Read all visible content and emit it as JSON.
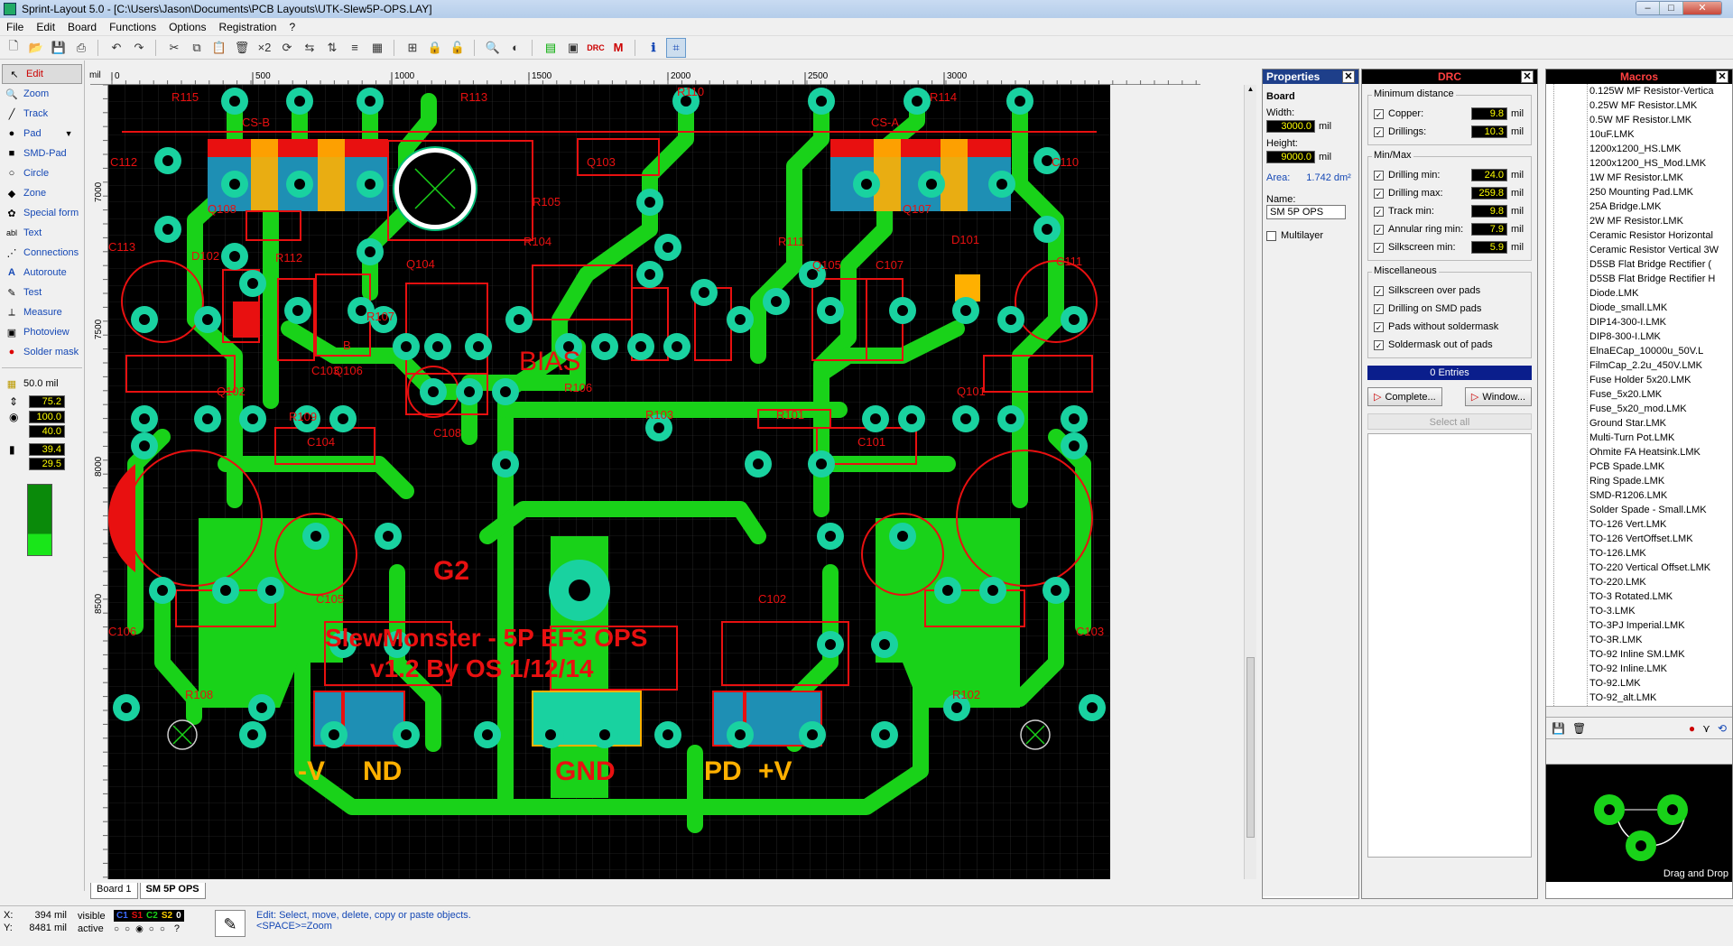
{
  "window": {
    "title": "Sprint-Layout 5.0 - [C:\\Users\\Jason\\Documents\\PCB Layouts\\UTK-Slew5P-OPS.LAY]",
    "min": "–",
    "max": "□",
    "close": "✕"
  },
  "menu": [
    "File",
    "Edit",
    "Board",
    "Functions",
    "Options",
    "Registration",
    "?"
  ],
  "tools": [
    {
      "label": "Edit",
      "icon": "↖"
    },
    {
      "label": "Zoom",
      "icon": "🔍"
    },
    {
      "label": "Track",
      "icon": "╱"
    },
    {
      "label": "Pad",
      "icon": "●"
    },
    {
      "label": "SMD-Pad",
      "icon": "■"
    },
    {
      "label": "Circle",
      "icon": "○"
    },
    {
      "label": "Zone",
      "icon": "◆"
    },
    {
      "label": "Special form",
      "icon": "✿"
    },
    {
      "label": "Text",
      "icon": "abl"
    },
    {
      "label": "Connections",
      "icon": "⋰"
    },
    {
      "label": "Autoroute",
      "icon": "A"
    },
    {
      "label": "Test",
      "icon": "✎"
    },
    {
      "label": "Measure",
      "icon": "⟂"
    },
    {
      "label": "Photoview",
      "icon": "▣"
    },
    {
      "label": "Solder mask",
      "icon": "●"
    }
  ],
  "grid_label": "50.0 mil",
  "track_width": "75.2",
  "pad_outer": "100.0",
  "pad_inner": "40.0",
  "smd_w": "39.4",
  "smd_h": "29.5",
  "ruler": {
    "unit": "mil",
    "top": [
      "0",
      "500",
      "1000",
      "1500",
      "2000",
      "2500",
      "3000"
    ],
    "left": [
      "7000",
      "7500",
      "8000",
      "8500"
    ]
  },
  "board_text": {
    "title1": "SlewMonster - 5P EF3 OPS",
    "title2": "v1.2 By OS 1/12/14",
    "bias": "BIAS",
    "g2": "G2",
    "minus_v": "-V",
    "nd": "ND",
    "gnd": "GND",
    "pd": "PD",
    "plus_v": "+V",
    "labels": [
      "R115",
      "R113",
      "R110",
      "R114",
      "CS-B",
      "CS-A",
      "C112",
      "C110",
      "Q108",
      "Q103",
      "Q107",
      "R105",
      "R104",
      "C113",
      "D102",
      "R112",
      "Q104",
      "R111",
      "Q105",
      "C107",
      "D101",
      "C111",
      "R107",
      "B",
      "C103",
      "Q106",
      "Q102",
      "R109",
      "C108",
      "R106",
      "R103",
      "R101",
      "Q101",
      "C104",
      "C101",
      "C106",
      "C105",
      "C102",
      "C103",
      "R108",
      "R102"
    ]
  },
  "tabs": [
    "Board 1",
    "SM 5P OPS"
  ],
  "properties": {
    "header": "Properties",
    "board": "Board",
    "width_label": "Width:",
    "width": "3000.0",
    "width_unit": "mil",
    "height_label": "Height:",
    "height": "9000.0",
    "height_unit": "mil",
    "area_label": "Area:",
    "area": "1.742 dm²",
    "name_label": "Name:",
    "name": "SM 5P OPS",
    "multilayer": "Multilayer"
  },
  "drc": {
    "header": "DRC",
    "min_dist": "Minimum distance",
    "copper": "Copper:",
    "copper_v": "9.8",
    "drillings": "Drillings:",
    "drillings_v": "10.3",
    "minmax": "Min/Max",
    "drill_min": "Drilling min:",
    "drill_min_v": "24.0",
    "drill_max": "Drilling max:",
    "drill_max_v": "259.8",
    "track_min": "Track min:",
    "track_min_v": "9.8",
    "annular": "Annular ring min:",
    "annular_v": "7.9",
    "silk_min": "Silkscreen min:",
    "silk_min_v": "5.9",
    "misc": "Miscellaneous",
    "m1": "Silkscreen over pads",
    "m2": "Drilling on SMD pads",
    "m3": "Pads without soldermask",
    "m4": "Soldermask out of pads",
    "unit": "mil",
    "entries": "0 Entries",
    "complete": "Complete...",
    "window": "Window...",
    "select_all": "Select all"
  },
  "macros": {
    "header": "Macros",
    "items": [
      "0.125W MF Resistor-Vertica",
      "0.25W MF Resistor.LMK",
      "0.5W MF Resistor.LMK",
      "10uF.LMK",
      "1200x1200_HS.LMK",
      "1200x1200_HS_Mod.LMK",
      "1W MF Resistor.LMK",
      "250 Mounting Pad.LMK",
      "25A Bridge.LMK",
      "2W MF Resistor.LMK",
      "Ceramic Resistor Horizontal",
      "Ceramic Resistor Vertical 3W",
      "D5SB Flat Bridge Rectifier (",
      "D5SB Flat Bridge Rectifier H",
      "Diode.LMK",
      "Diode_small.LMK",
      "DIP14-300-I.LMK",
      "DIP8-300-I.LMK",
      "ElnaECap_10000u_50V.L",
      "FilmCap_2.2u_450V.LMK",
      "Fuse Holder 5x20.LMK",
      "Fuse_5x20.LMK",
      "Fuse_5x20_mod.LMK",
      "Ground Star.LMK",
      "Multi-Turn Pot.LMK",
      "Ohmite FA Heatsink.LMK",
      "PCB Spade.LMK",
      "Ring Spade.LMK",
      "SMD-R1206.LMK",
      "Solder Spade - Small.LMK",
      "TO-126 Vert.LMK",
      "TO-126 VertOffset.LMK",
      "TO-126.LMK",
      "TO-220 Vertical Offset.LMK",
      "TO-220.LMK",
      "TO-3 Rotated.LMK",
      "TO-3.LMK",
      "TO-3PJ Imperial.LMK",
      "TO-3R.LMK",
      "TO-92 Inline SM.LMK",
      "TO-92 Inline.LMK",
      "TO-92.LMK",
      "TO-92_alt.LMK"
    ],
    "drag": "Drag and Drop"
  },
  "status": {
    "x_label": "X:",
    "x": "394 mil",
    "y_label": "Y:",
    "y": "8481 mil",
    "visible": "visible",
    "active": "active",
    "layers": [
      "C1",
      "S1",
      "C2",
      "S2",
      "0"
    ],
    "help1": "Edit: Select, move, delete, copy or paste objects.",
    "help2": "<SPACE>=Zoom"
  },
  "colors": {
    "track": "#19d219",
    "pad": "#19d2a0",
    "silk": "#e81010",
    "board": "#000000",
    "copper_top": "#1e8fb4"
  }
}
